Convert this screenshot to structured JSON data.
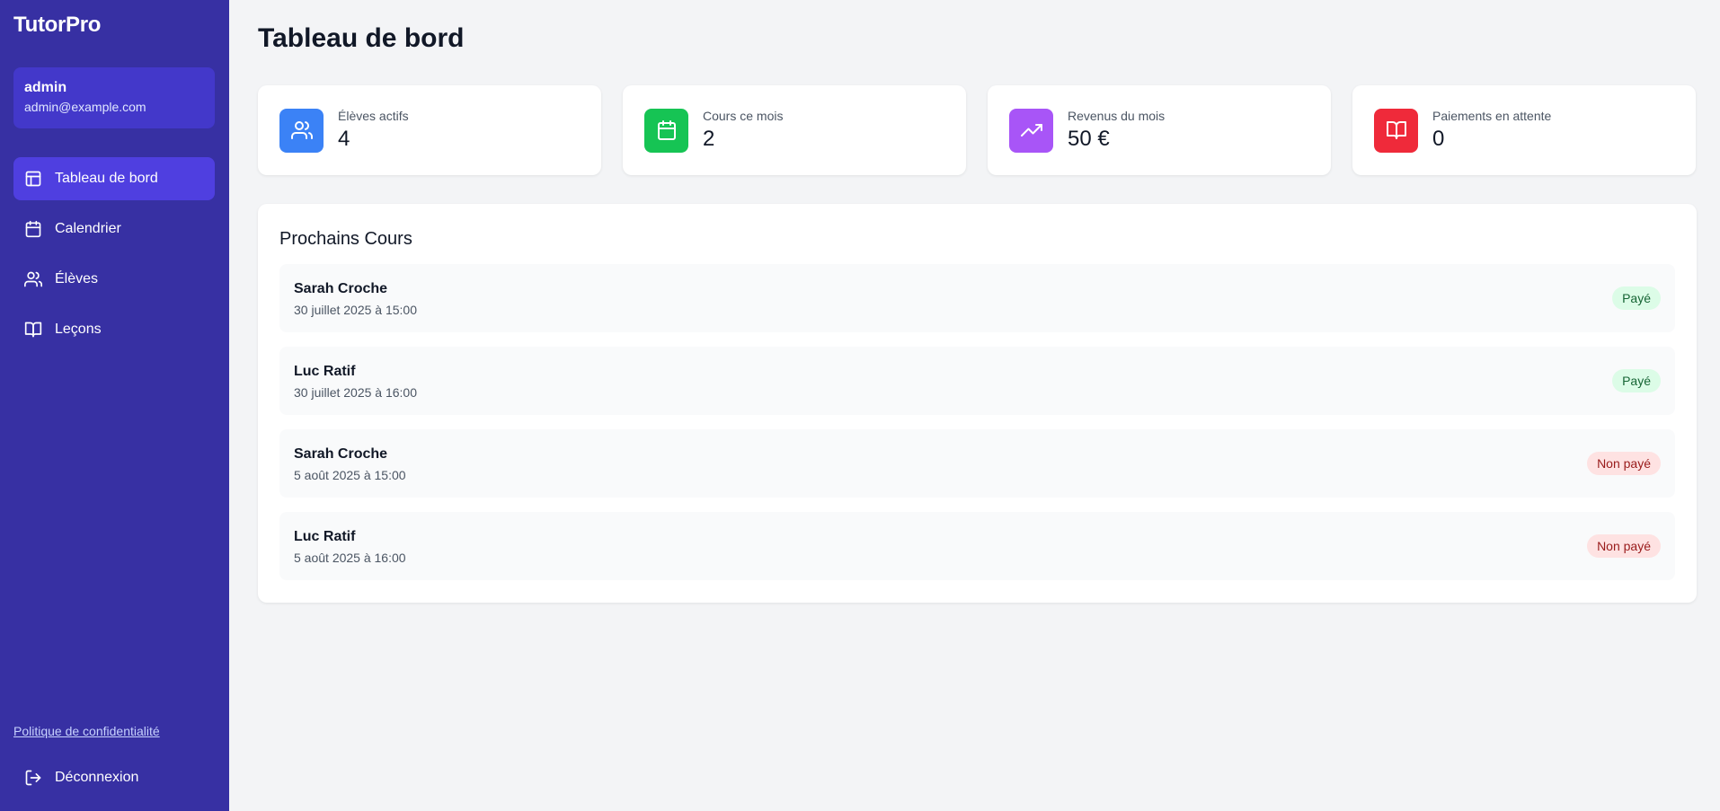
{
  "app": {
    "name": "TutorPro"
  },
  "user": {
    "name": "admin",
    "email": "admin@example.com"
  },
  "nav": [
    {
      "label": "Tableau de bord",
      "icon": "layout-icon",
      "active": true
    },
    {
      "label": "Calendrier",
      "icon": "calendar-icon",
      "active": false
    },
    {
      "label": "Élèves",
      "icon": "users-icon",
      "active": false
    },
    {
      "label": "Leçons",
      "icon": "book-icon",
      "active": false
    }
  ],
  "footer": {
    "privacy_link": "Politique de confidentialité",
    "logout_label": "Déconnexion"
  },
  "page": {
    "title": "Tableau de bord"
  },
  "stats": [
    {
      "label": "Élèves actifs",
      "value": "4",
      "icon": "users-icon",
      "color": "#3b82f6"
    },
    {
      "label": "Cours ce mois",
      "value": "2",
      "icon": "calendar-icon",
      "color": "#16c454"
    },
    {
      "label": "Revenus du mois",
      "value": "50 €",
      "icon": "trending-up-icon",
      "color": "#a855f7"
    },
    {
      "label": "Paiements en attente",
      "value": "0",
      "icon": "book-open-icon",
      "color": "#ef2a3a"
    }
  ],
  "upcoming": {
    "title": "Prochains Cours",
    "items": [
      {
        "student": "Sarah Croche",
        "date": "30 juillet 2025 à 15:00",
        "status": "Payé",
        "paid": true
      },
      {
        "student": "Luc Ratif",
        "date": "30 juillet 2025 à 16:00",
        "status": "Payé",
        "paid": true
      },
      {
        "student": "Sarah Croche",
        "date": "5 août 2025 à 15:00",
        "status": "Non payé",
        "paid": false
      },
      {
        "student": "Luc Ratif",
        "date": "5 août 2025 à 16:00",
        "status": "Non payé",
        "paid": false
      }
    ]
  }
}
